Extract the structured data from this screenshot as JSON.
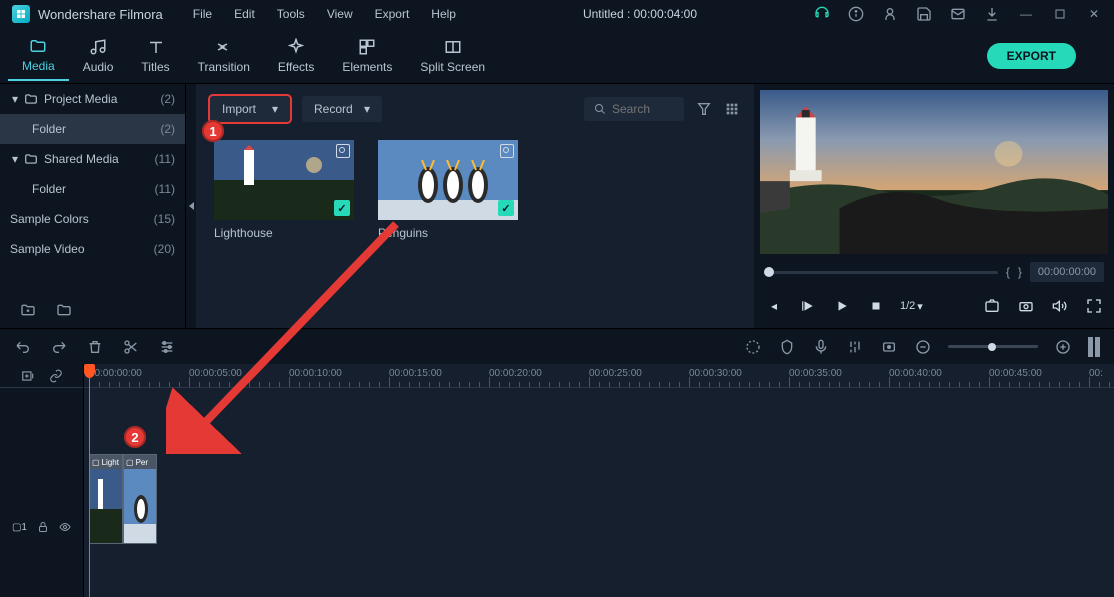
{
  "app": {
    "title": "Wondershare Filmora"
  },
  "menu": [
    "File",
    "Edit",
    "Tools",
    "View",
    "Export",
    "Help"
  ],
  "doc_title": "Untitled : 00:00:04:00",
  "export_label": "EXPORT",
  "tabs": [
    {
      "label": "Media",
      "icon": "folder-icon",
      "active": true
    },
    {
      "label": "Audio",
      "icon": "music-icon"
    },
    {
      "label": "Titles",
      "icon": "text-icon"
    },
    {
      "label": "Transition",
      "icon": "transition-icon"
    },
    {
      "label": "Effects",
      "icon": "sparkle-icon"
    },
    {
      "label": "Elements",
      "icon": "elements-icon"
    },
    {
      "label": "Split Screen",
      "icon": "split-icon"
    }
  ],
  "sidebar": {
    "items": [
      {
        "label": "Project Media",
        "count": "(2)",
        "expandable": true,
        "expanded": true
      },
      {
        "label": "Folder",
        "count": "(2)",
        "selected": true,
        "indent": true
      },
      {
        "label": "Shared Media",
        "count": "(11)",
        "expandable": true,
        "expanded": true
      },
      {
        "label": "Folder",
        "count": "(11)",
        "indent": true
      },
      {
        "label": "Sample Colors",
        "count": "(15)"
      },
      {
        "label": "Sample Video",
        "count": "(20)"
      }
    ]
  },
  "media_top": {
    "import_label": "Import",
    "record_label": "Record",
    "search_placeholder": "Search"
  },
  "thumbs": [
    {
      "label": "Lighthouse"
    },
    {
      "label": "Penguins"
    }
  ],
  "preview": {
    "brackets": {
      "open": "{",
      "close": "}"
    },
    "timecode": "00:00:00:00",
    "speed": "1/2"
  },
  "ruler_marks": [
    "00:00:00:00",
    "00:00:05:00",
    "00:00:10:00",
    "00:00:15:00",
    "00:00:20:00",
    "00:00:25:00",
    "00:00:30:00",
    "00:00:35:00",
    "00:00:40:00",
    "00:00:45:00",
    "00:"
  ],
  "clips": [
    {
      "label": "Light"
    },
    {
      "label": "Per"
    }
  ],
  "annots": {
    "one": "1",
    "two": "2"
  },
  "track_head": "▢1"
}
